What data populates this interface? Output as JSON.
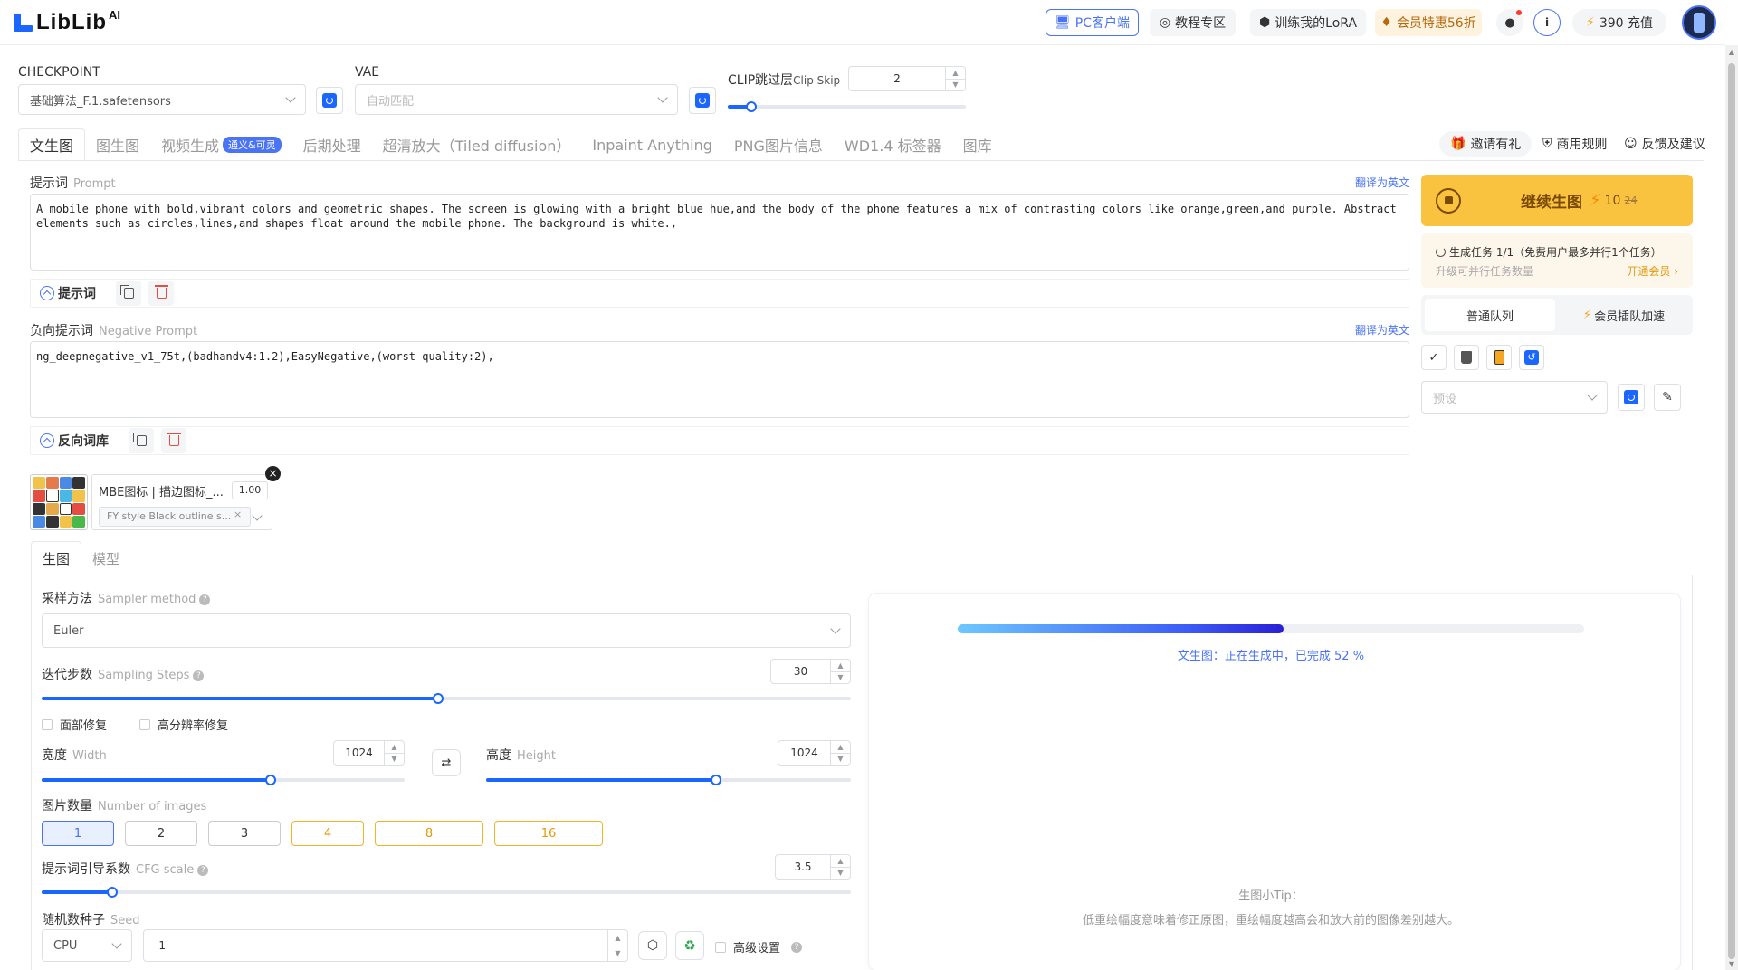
{
  "header": {
    "logo_text": "LibLib",
    "logo_sup": "AI",
    "pc_client": "PC客户端",
    "tutorials": "教程专区",
    "train_lora": "训练我的LoRA",
    "vip": "会员特惠56折",
    "recharge": "390 充值"
  },
  "model": {
    "checkpoint_label": "CHECKPOINT",
    "checkpoint_value": "基础算法_F.1.safetensors",
    "vae_label": "VAE",
    "vae_value": "自动匹配",
    "clip_label": "CLIP跳过层",
    "clip_label_en": "Clip Skip",
    "clip_value": "2",
    "clip_slider_fraction": 0.1
  },
  "tabs": [
    {
      "label": "文生图"
    },
    {
      "label": "图生图"
    },
    {
      "label": "视频生成",
      "badge": "通义&可灵"
    },
    {
      "label": "后期处理"
    },
    {
      "label": "超清放大（Tiled diffusion）"
    },
    {
      "label": "Inpaint Anything"
    },
    {
      "label": "PNG图片信息"
    },
    {
      "label": "WD1.4 标签器"
    },
    {
      "label": "图库"
    }
  ],
  "top_links": {
    "invite": "邀请有礼",
    "commercial": "商用规则",
    "feedback": "反馈及建议"
  },
  "prompt": {
    "label": "提示词",
    "label_en": "Prompt",
    "translate": "翻译为英文",
    "text": "A mobile phone with bold,vibrant colors and geometric shapes. The screen is glowing with a bright blue hue,and the body of the phone features a mix of contrasting colors like orange,green,and purple. Abstract elements such as circles,lines,and shapes float around the mobile phone. The background is white.,",
    "bar_label": "提示词"
  },
  "negative": {
    "label": "负向提示词",
    "label_en": "Negative Prompt",
    "translate": "翻译为英文",
    "text": "ng_deepnegative_v1_75t,(badhandv4:1.2),EasyNegative,(worst quality:2),",
    "bar_label": "反向词库"
  },
  "lora": {
    "name": "MBE图标 | 描边图标_...",
    "weight": "1.00",
    "trigger": "FY style Black outline s..."
  },
  "right_panel": {
    "generate_label": "继续生图",
    "cost": "10",
    "cost_old": "24",
    "task_line": "生成任务 1/1（免费用户最多并行1个任务）",
    "task_upgrade": "升级可并行任务数量",
    "task_vip": "开通会员 ›",
    "queue_normal": "普通队列",
    "queue_vip": "会员插队加速",
    "preset_placeholder": "预设"
  },
  "subtabs": [
    "生图",
    "模型"
  ],
  "params": {
    "sampler_label": "采样方法",
    "sampler_label_en": "Sampler method",
    "sampler_value": "Euler",
    "steps_label": "迭代步数",
    "steps_label_en": "Sampling Steps",
    "steps_value": "30",
    "steps_fraction": 0.49,
    "face_fix": "面部修复",
    "hires_fix": "高分辨率修复",
    "width_label": "宽度",
    "width_label_en": "Width",
    "width_value": "1024",
    "width_fraction": 0.63,
    "height_label": "高度",
    "height_label_en": "Height",
    "height_value": "1024",
    "height_fraction": 0.63,
    "num_images_label": "图片数量",
    "num_images_label_en": "Number of images",
    "num_images_options": [
      "1",
      "2",
      "3",
      "4",
      "8",
      "16"
    ],
    "num_images_selected": "1",
    "cfg_label": "提示词引导系数",
    "cfg_label_en": "CFG scale",
    "cfg_value": "3.5",
    "cfg_fraction": 0.087,
    "seed_label": "随机数种子",
    "seed_label_en": "Seed",
    "seed_device": "CPU",
    "seed_value": "-1",
    "advanced": "高级设置"
  },
  "preview": {
    "progress_percent": 52,
    "status": "文生图：正在生成中，已完成 52 %",
    "tip_title": "生图小Tip：",
    "tip_text": "低重绘幅度意味着修正原图，重绘幅度越高会和放大前的图像差别越大。"
  },
  "colors": {
    "accent": "#1a66ff",
    "gen_button": "#f9c33f",
    "gold": "#e29a0c"
  }
}
